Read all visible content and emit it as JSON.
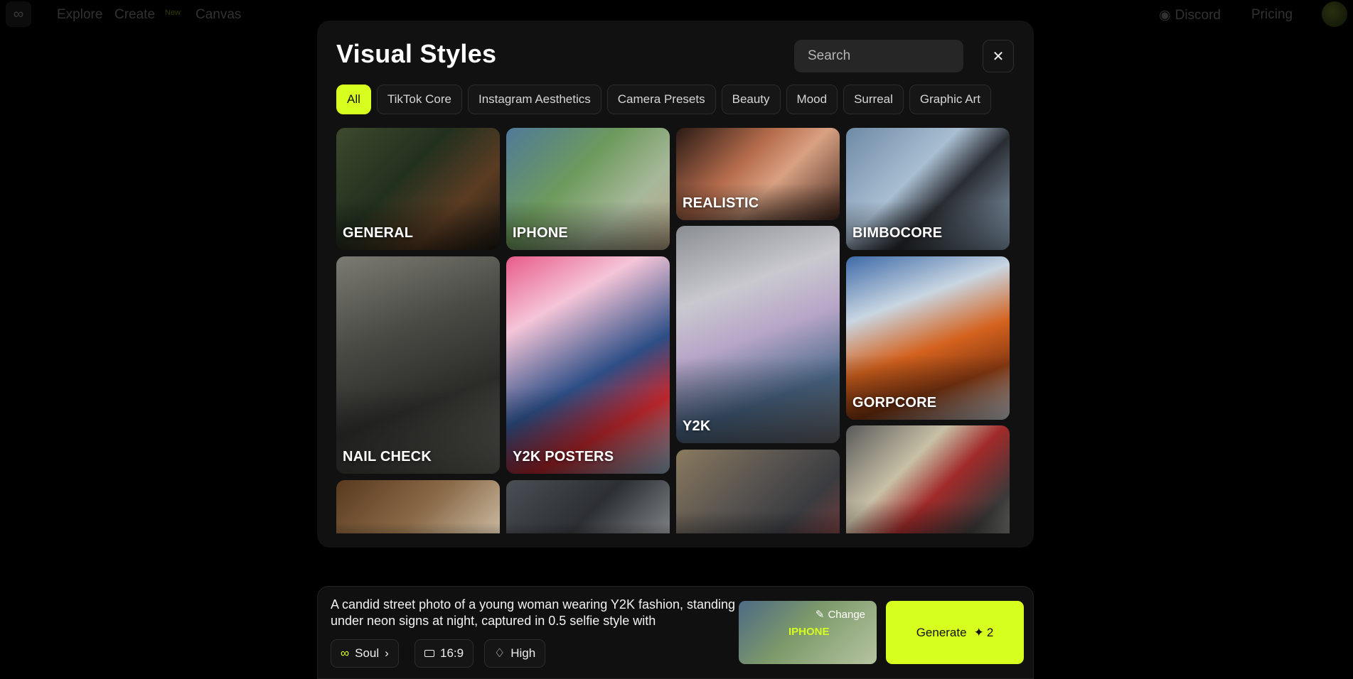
{
  "nav": {
    "links": [
      "Explore",
      "Create",
      "Canvas"
    ],
    "new_badge": "New",
    "discord": "Discord",
    "pricing": "Pricing"
  },
  "modal": {
    "title": "Visual Styles",
    "search_placeholder": "Search",
    "close_icon": "close-icon",
    "filters": [
      "All",
      "TikTok Core",
      "Instagram Aesthetics",
      "Camera Presets",
      "Beauty",
      "Mood",
      "Surreal",
      "Graphic Art"
    ],
    "active_filter": "All",
    "styles": [
      "GENERAL",
      "IPHONE",
      "REALISTIC",
      "BIMBOCORE",
      "NAIL CHECK",
      "Y2K POSTERS",
      "Y2K",
      "GORPCORE"
    ]
  },
  "composer": {
    "prompt": "A candid street photo of a young woman wearing Y2K fashion, standing under neon signs at night, captured in 0.5 selfie style with",
    "model": "Soul",
    "aspect_ratio": "16:9",
    "quality": "High",
    "selected_style": "IPHONE",
    "change_label": "Change",
    "generate_label": "Generate",
    "credits": "2"
  },
  "colors": {
    "accent": "#d6ff1f",
    "modal_bg": "#111111",
    "page_bg": "#000000"
  }
}
